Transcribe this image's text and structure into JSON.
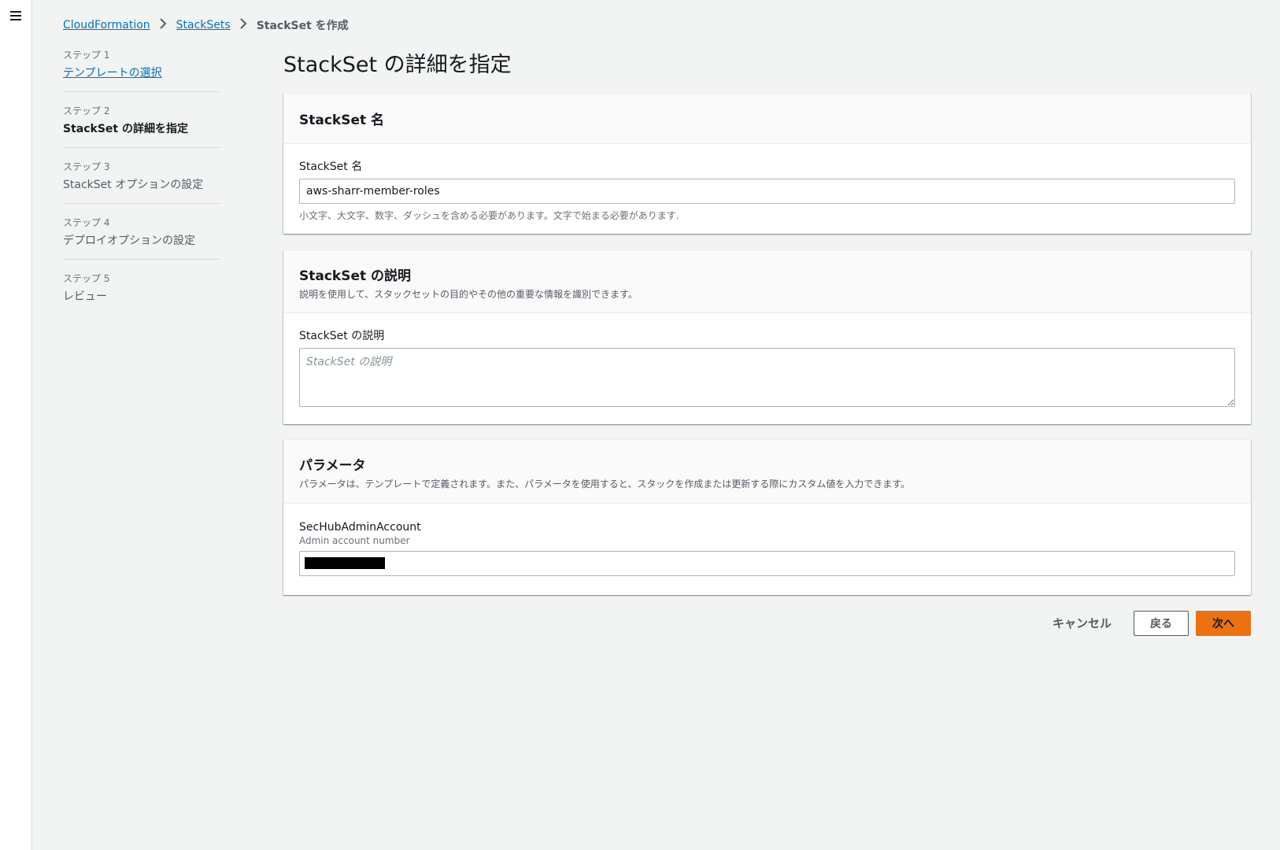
{
  "breadcrumb": {
    "items": [
      "CloudFormation",
      "StackSets"
    ],
    "current": "StackSet を作成"
  },
  "steps": [
    {
      "num": "ステップ 1",
      "title": "テンプレートの選択",
      "state": "link"
    },
    {
      "num": "ステップ 2",
      "title": "StackSet の詳細を指定",
      "state": "active"
    },
    {
      "num": "ステップ 3",
      "title": "StackSet オプションの設定",
      "state": "pending"
    },
    {
      "num": "ステップ 4",
      "title": "デプロイオプションの設定",
      "state": "pending"
    },
    {
      "num": "ステップ 5",
      "title": "レビュー",
      "state": "pending"
    }
  ],
  "page_title": "StackSet の詳細を指定",
  "name_panel": {
    "title": "StackSet 名",
    "label": "StackSet 名",
    "value": "aws-sharr-member-roles",
    "hint": "小文字、大文字、数字、ダッシュを含める必要があります。文字で始まる必要があります."
  },
  "desc_panel": {
    "title": "StackSet の説明",
    "description": "説明を使用して、スタックセットの目的やその他の重要な情報を識別できます。",
    "label": "StackSet の説明",
    "placeholder": "StackSet の説明"
  },
  "params_panel": {
    "title": "パラメータ",
    "description": "パラメータは、テンプレートで定義されます。また、パラメータを使用すると、スタックを作成または更新する際にカスタム値を入力できます。",
    "param_name": "SecHubAdminAccount",
    "param_desc": "Admin account number"
  },
  "actions": {
    "cancel": "キャンセル",
    "back": "戻る",
    "next": "次へ"
  },
  "colors": {
    "link": "#0073bb",
    "primary": "#ec7211",
    "background": "#f2f3f3"
  }
}
